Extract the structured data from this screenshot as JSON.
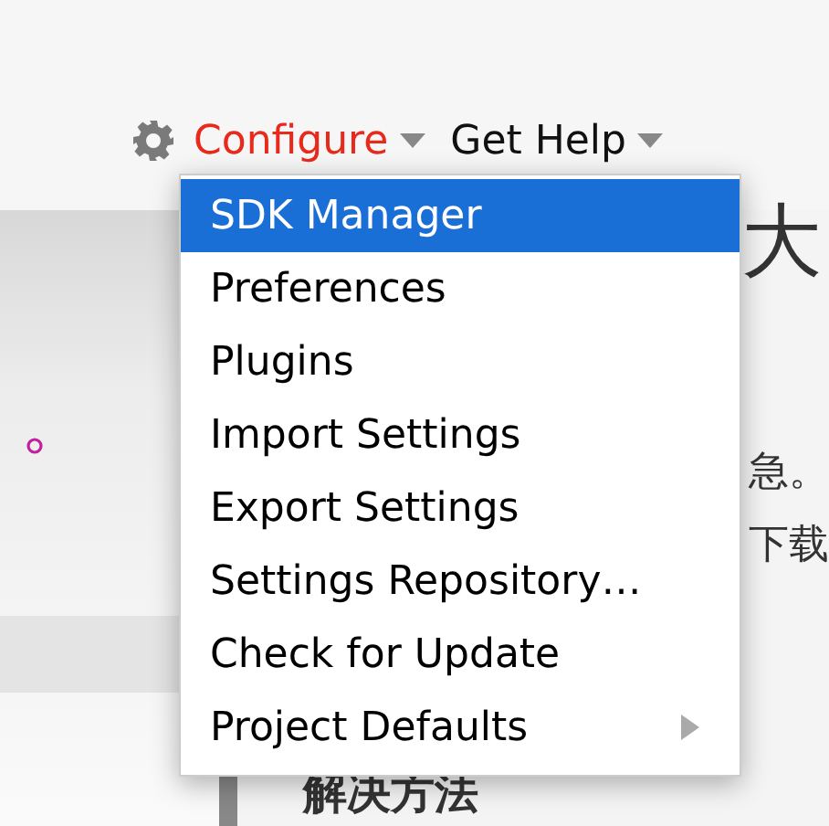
{
  "toolbar": {
    "items": [
      {
        "label": "Configure",
        "kind": "configure",
        "selected": true
      },
      {
        "label": "Get Help",
        "kind": "help",
        "selected": false
      }
    ]
  },
  "menu": {
    "items": [
      {
        "label": "SDK Manager",
        "selected": true,
        "submenu": false
      },
      {
        "label": "Preferences",
        "selected": false,
        "submenu": false
      },
      {
        "label": "Plugins",
        "selected": false,
        "submenu": false
      },
      {
        "label": "Import Settings",
        "selected": false,
        "submenu": false
      },
      {
        "label": "Export Settings",
        "selected": false,
        "submenu": false
      },
      {
        "label": "Settings Repository…",
        "selected": false,
        "submenu": false
      },
      {
        "label": "Check for Update",
        "selected": false,
        "submenu": false
      },
      {
        "label": "Project Defaults",
        "selected": false,
        "submenu": true
      }
    ]
  },
  "article": {
    "heading_fragment": "大",
    "line_1_fragment": "急。",
    "line_2_fragment": "下载",
    "section_heading": "解决方法"
  }
}
